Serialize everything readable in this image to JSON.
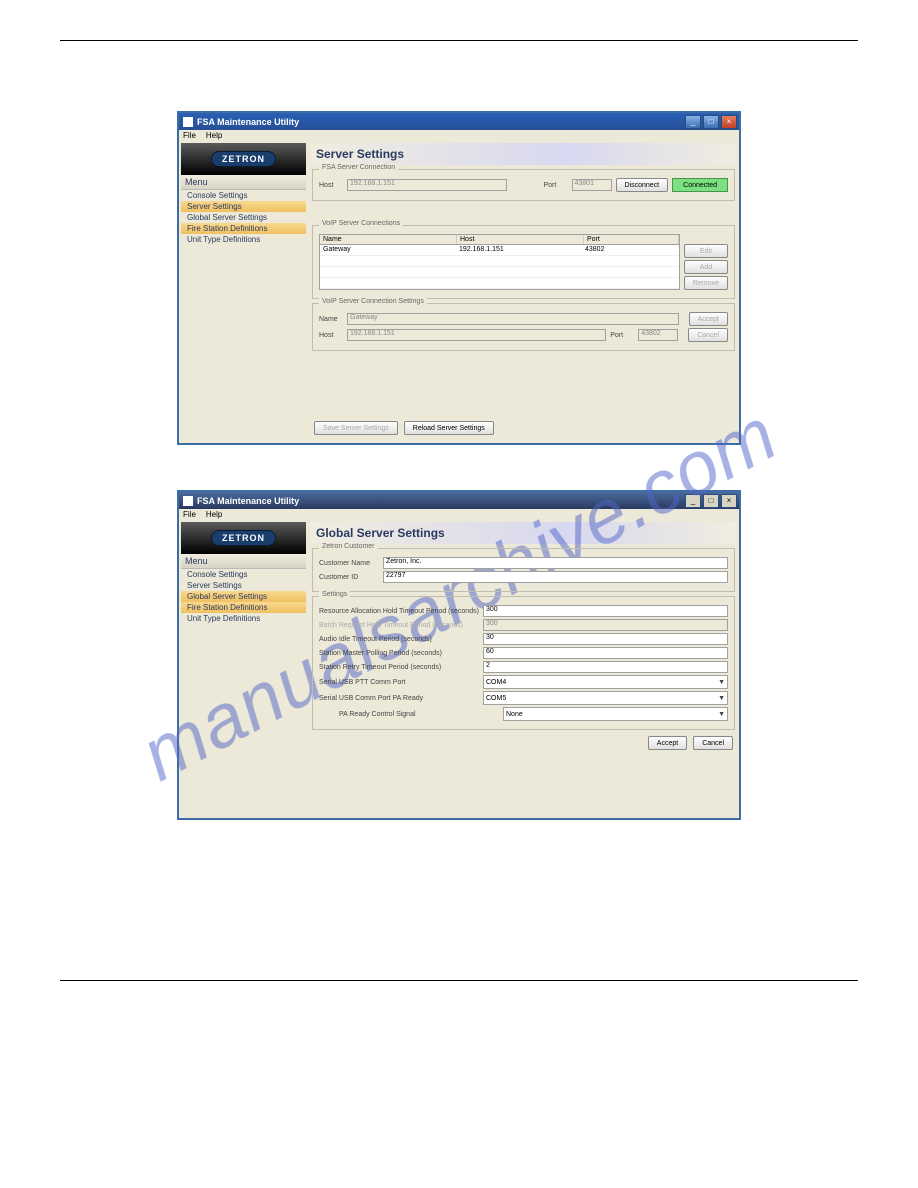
{
  "watermark": "manualsarchive.com",
  "win1": {
    "title": "FSA Maintenance Utility",
    "menubar": [
      "File",
      "Help"
    ],
    "logo": "ZETRON",
    "menu_label": "Menu",
    "menu_items": [
      "Console Settings",
      "Server Settings",
      "Global Server Settings",
      "Fire Station Definitions",
      "Unit Type Definitions"
    ],
    "menu_selected": 1,
    "content_title": "Server Settings",
    "fsa_group": "FSA Server Connection",
    "host_label": "Host",
    "host_value": "192.168.1.151",
    "port_label": "Port",
    "port_value": "43801",
    "disconnect": "Disconnect",
    "connected": "Connected",
    "voip_group": "VoIP Server Connections",
    "cols": {
      "name": "Name",
      "host": "Host",
      "port": "Port"
    },
    "rows": [
      {
        "name": "Gateway",
        "host": "192.168.1.151",
        "port": "43802"
      }
    ],
    "btn_edit": "Edit",
    "btn_add": "Add",
    "btn_remove": "Remove",
    "voip_set_group": "VoIP Server Connection Settings",
    "name_label": "Name",
    "name_value": "Gateway",
    "host2_value": "192.168.1.151",
    "port2_value": "43802",
    "btn_accept": "Accept",
    "btn_cancel": "Cancel",
    "save": "Save Server Settings",
    "reload": "Reload Server Settings"
  },
  "win2": {
    "title": "FSA Maintenance Utility",
    "menubar": [
      "File",
      "Help"
    ],
    "logo": "ZETRON",
    "menu_label": "Menu",
    "menu_items": [
      "Console Settings",
      "Server Settings",
      "Global Server Settings",
      "Fire Station Definitions",
      "Unit Type Definitions"
    ],
    "menu_selected": 2,
    "content_title": "Global Server Settings",
    "cust_group": "Zetron Customer",
    "cust_name_label": "Customer Name",
    "cust_name_value": "Zetron, Inc.",
    "cust_id_label": "Customer ID",
    "cust_id_value": "22797",
    "settings_group": "Settings",
    "f1": {
      "label": "Resource Allocation Hold Timeout Period  (seconds)",
      "value": "300"
    },
    "f2": {
      "label": "Batch Request Hold Timeout Period  (seconds)",
      "value": "300"
    },
    "f3": {
      "label": "Audio Idle Timeout Period  (seconds)",
      "value": "30"
    },
    "f4": {
      "label": "Station Master Polling Period  (seconds)",
      "value": "60"
    },
    "f5": {
      "label": "Station Retry Timeout Period  (seconds)",
      "value": "2"
    },
    "f6": {
      "label": "Serial USB PTT Comm Port",
      "value": "COM4"
    },
    "f7": {
      "label": "Serial USB Comm Port PA Ready",
      "value": "COM5"
    },
    "f8": {
      "label": "PA Ready Control Signal",
      "value": "None"
    },
    "accept": "Accept",
    "cancel": "Cancel"
  }
}
